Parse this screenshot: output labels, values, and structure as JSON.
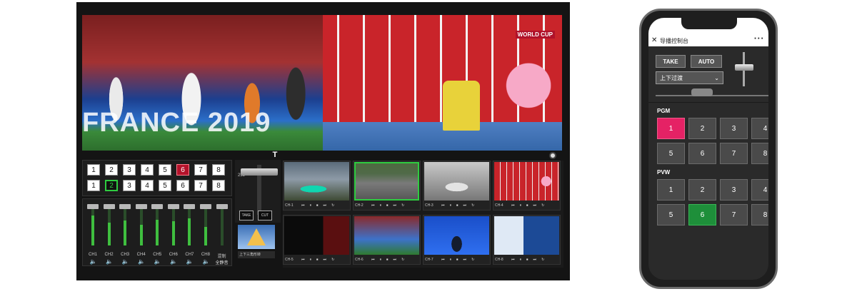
{
  "console": {
    "main_banner": "FRANCE 2019",
    "volley_tag": "WORLD CUP",
    "t_icon": "T",
    "tbar_value": "255",
    "take_label": "TAKE",
    "cut_label": "CUT",
    "transition_label": "上下三角形转",
    "program_row": [
      "1",
      "2",
      "3",
      "4",
      "5",
      "6",
      "7",
      "8"
    ],
    "preview_row": [
      "1",
      "2",
      "3",
      "4",
      "5",
      "6",
      "7",
      "8"
    ],
    "program_active": "6",
    "preview_active": "2",
    "mixer": [
      {
        "label": "CH1",
        "level": 0.72
      },
      {
        "label": "CH2",
        "level": 0.55
      },
      {
        "label": "CH3",
        "level": 0.6
      },
      {
        "label": "CH4",
        "level": 0.5
      },
      {
        "label": "CH5",
        "level": 0.62
      },
      {
        "label": "CH6",
        "level": 0.58
      },
      {
        "label": "CH7",
        "level": 0.65
      },
      {
        "label": "CH8",
        "level": 0.45
      },
      {
        "label": "混制",
        "level": 0.0,
        "sub": "全静音"
      }
    ],
    "channels": [
      {
        "label": "CH-1"
      },
      {
        "label": "CH-2"
      },
      {
        "label": "CH-3"
      },
      {
        "label": "CH-4"
      },
      {
        "label": "CH-5"
      },
      {
        "label": "CH-6"
      },
      {
        "label": "CH-7"
      },
      {
        "label": "CH-8"
      }
    ]
  },
  "phone": {
    "title": "导播控制台",
    "take_label": "TAKE",
    "auto_label": "AUTO",
    "transition_select": "上下过渡",
    "pgm_label": "PGM",
    "pvw_label": "PVW",
    "pgm_buttons": [
      "1",
      "2",
      "3",
      "4",
      "5",
      "6",
      "7",
      "8"
    ],
    "pvw_buttons": [
      "1",
      "2",
      "3",
      "4",
      "5",
      "6",
      "7",
      "8"
    ],
    "pgm_active": "1",
    "pvw_active": "6"
  },
  "icons": [
    "close-icon",
    "more-icon",
    "chevron-down-icon",
    "speaker-icon",
    "play-icon",
    "pause-icon",
    "stop-icon",
    "prev-icon",
    "next-icon",
    "record-icon"
  ]
}
